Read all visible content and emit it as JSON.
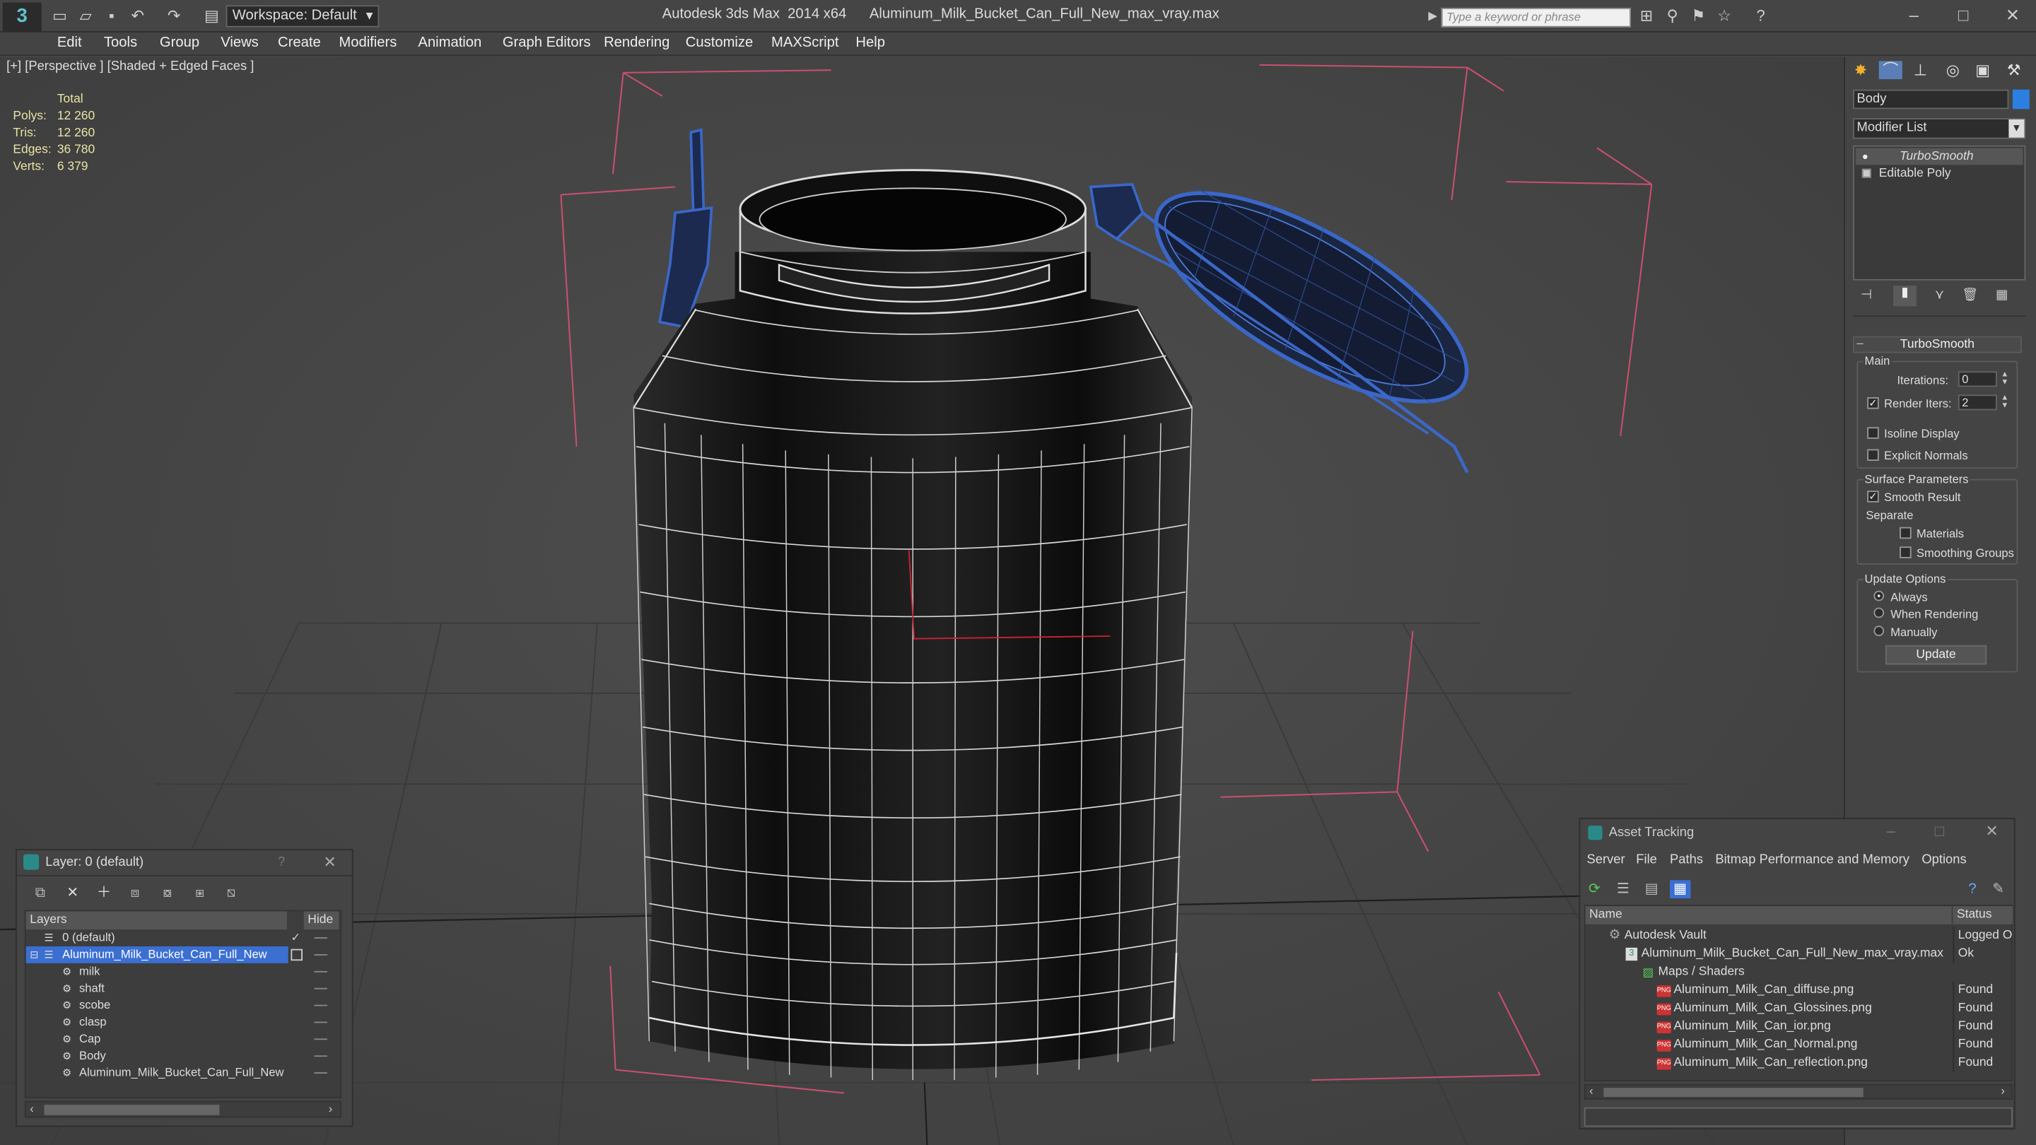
{
  "app": {
    "title": "Autodesk 3ds Max  2014 x64",
    "filename": "Aluminum_Milk_Bucket_Can_Full_New_max_vray.max",
    "workspace": "Workspace: Default",
    "search_placeholder": "Type a keyword or phrase"
  },
  "menu": [
    "Edit",
    "Tools",
    "Group",
    "Views",
    "Create",
    "Modifiers",
    "Animation",
    "Graph Editors",
    "Rendering",
    "Customize",
    "MAXScript",
    "Help"
  ],
  "viewport": {
    "label": "[+] [Perspective ] [Shaded + Edged Faces ]",
    "stats": {
      "header": "Total",
      "rows": [
        {
          "k": "Polys:",
          "v": "12 260"
        },
        {
          "k": "Tris:",
          "v": "12 260"
        },
        {
          "k": "Edges:",
          "v": "36 780"
        },
        {
          "k": "Verts:",
          "v": "6 379"
        }
      ]
    }
  },
  "command_panel": {
    "object_name": "Body",
    "object_color": "#2b7fe0",
    "modifier_list": "Modifier List",
    "stack": [
      "TurboSmooth",
      "Editable Poly"
    ],
    "rollout_title": "TurboSmooth",
    "main": {
      "title": "Main",
      "iterations_label": "Iterations:",
      "iterations_value": "0",
      "render_iters_label": "Render Iters:",
      "render_iters_value": "2",
      "render_iters_checked": true,
      "isoline_label": "Isoline Display",
      "explicit_label": "Explicit Normals"
    },
    "surface": {
      "title": "Surface Parameters",
      "smooth_result_label": "Smooth Result",
      "separate_label": "Separate",
      "materials_label": "Materials",
      "smoothing_label": "Smoothing Groups"
    },
    "update": {
      "title": "Update Options",
      "always": "Always",
      "when_rendering": "When Rendering",
      "manually": "Manually",
      "button": "Update"
    }
  },
  "layer_dialog": {
    "title": "Layer: 0 (default)",
    "help": "?",
    "col_layers": "Layers",
    "col_hide": "Hide",
    "rows": [
      {
        "name": "0 (default)",
        "level": 1,
        "type": "layer"
      },
      {
        "name": "Aluminum_Milk_Bucket_Can_Full_New",
        "level": 1,
        "type": "layer",
        "selected": true
      },
      {
        "name": "milk",
        "level": 2,
        "type": "object"
      },
      {
        "name": "shaft",
        "level": 2,
        "type": "object"
      },
      {
        "name": "scobe",
        "level": 2,
        "type": "object"
      },
      {
        "name": "clasp",
        "level": 2,
        "type": "object"
      },
      {
        "name": "Cap",
        "level": 2,
        "type": "object"
      },
      {
        "name": "Body",
        "level": 2,
        "type": "object"
      },
      {
        "name": "Aluminum_Milk_Bucket_Can_Full_New",
        "level": 2,
        "type": "object"
      }
    ]
  },
  "asset_dialog": {
    "title": "Asset Tracking",
    "menu": [
      "Server",
      "File",
      "Paths",
      "Bitmap Performance and Memory",
      "Options"
    ],
    "col_name": "Name",
    "col_status": "Status",
    "rows": [
      {
        "name": "Autodesk Vault",
        "status": "Logged Out",
        "level": 0,
        "icon": "vault"
      },
      {
        "name": "Aluminum_Milk_Bucket_Can_Full_New_max_vray.max",
        "status": "Ok",
        "level": 1,
        "icon": "max"
      },
      {
        "name": "Maps / Shaders",
        "status": "",
        "level": 2,
        "icon": "maps"
      },
      {
        "name": "Aluminum_Milk_Can_diffuse.png",
        "status": "Found",
        "level": 3,
        "icon": "png"
      },
      {
        "name": "Aluminum_Milk_Can_Glossines.png",
        "status": "Found",
        "level": 3,
        "icon": "png"
      },
      {
        "name": "Aluminum_Milk_Can_ior.png",
        "status": "Found",
        "level": 3,
        "icon": "png"
      },
      {
        "name": "Aluminum_Milk_Can_Normal.png",
        "status": "Found",
        "level": 3,
        "icon": "png"
      },
      {
        "name": "Aluminum_Milk_Can_reflection.png",
        "status": "Found",
        "level": 3,
        "icon": "png"
      }
    ]
  }
}
